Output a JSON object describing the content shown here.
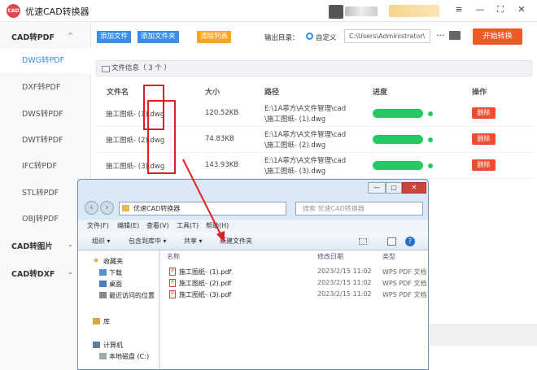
{
  "app": {
    "title": "优速CAD转换器",
    "logo_text": "CAD"
  },
  "window_controls": {
    "menu": "≡",
    "minimize": "—",
    "maximize": "⛶",
    "close": "✕"
  },
  "sidebar": {
    "groups": [
      {
        "label": "CAD转PDF",
        "chevron": "^"
      },
      {
        "label": "CAD转图片",
        "chevron": "⌄"
      },
      {
        "label": "CAD转DXF",
        "chevron": "⌄"
      }
    ],
    "items": [
      "DWG转PDF",
      "DXF转PDF",
      "DWS转PDF",
      "DWT转PDF",
      "IFC转PDF",
      "STL转PDF",
      "OBJ转PDF"
    ],
    "active_index": 0
  },
  "toolbar": {
    "add_file": "添加文件",
    "add_folder": "添加文件夹",
    "clear_list": "清除列表",
    "output_label": "输出目录：",
    "custom_label": "自定义",
    "output_path": "C:\\Users\\Administrator\\",
    "more": "···",
    "start": "开始转换",
    "colors": {
      "blue": "#3a8ee6",
      "orange": "#f5a623",
      "start": "#f05b25"
    }
  },
  "file_info": {
    "label": "文件信息（ 3 个 ）"
  },
  "table": {
    "headers": {
      "name": "文件名",
      "size": "大小",
      "path": "路径",
      "progress": "进度",
      "action": "操作"
    },
    "rows": [
      {
        "name": "施工图纸- (1).dwg",
        "size": "120.52KB",
        "path1": "E:\\1A菲方\\A文件管理\\cad",
        "path2": "\\施工图纸- (1).dwg",
        "progress": 1,
        "delete": "删除"
      },
      {
        "name": "施工图纸- (2).dwg",
        "size": "74.83KB",
        "path1": "E:\\1A菲方\\A文件管理\\cad",
        "path2": "\\施工图纸- (2).dwg",
        "progress": 1,
        "delete": "删除"
      },
      {
        "name": "施工图纸- (3).dwg",
        "size": "143.93KB",
        "path1": "E:\\1A菲方\\A文件管理\\cad",
        "path2": "\\施工图纸- (3).dwg",
        "progress": 1,
        "delete": "删除"
      }
    ]
  },
  "explorer": {
    "address": "优速CAD转换器",
    "search_placeholder": "搜索 优速CAD转换器",
    "menu": [
      "文件(F)",
      "编辑(E)",
      "查看(V)",
      "工具(T)",
      "帮助(H)"
    ],
    "commands": [
      "组织 ▾",
      "包含到库中 ▾",
      "共享 ▾",
      "新建文件夹"
    ],
    "nav": {
      "favorites": "收藏夹",
      "downloads": "下载",
      "desktop": "桌面",
      "recent": "最近访问的位置",
      "library": "库",
      "computer": "计算机",
      "disk": "本地磁盘 (C:)"
    },
    "columns": {
      "name": "名称",
      "date": "修改日期",
      "type": "类型"
    },
    "files": [
      {
        "name": "施工图纸- (1).pdf",
        "date": "2023/2/15 11:02",
        "type": "WPS PDF 文档"
      },
      {
        "name": "施工图纸- (2).pdf",
        "date": "2023/2/15 11:02",
        "type": "WPS PDF 文档"
      },
      {
        "name": "施工图纸- (3).pdf",
        "date": "2023/2/15 11:02",
        "type": "WPS PDF 文档"
      }
    ]
  }
}
